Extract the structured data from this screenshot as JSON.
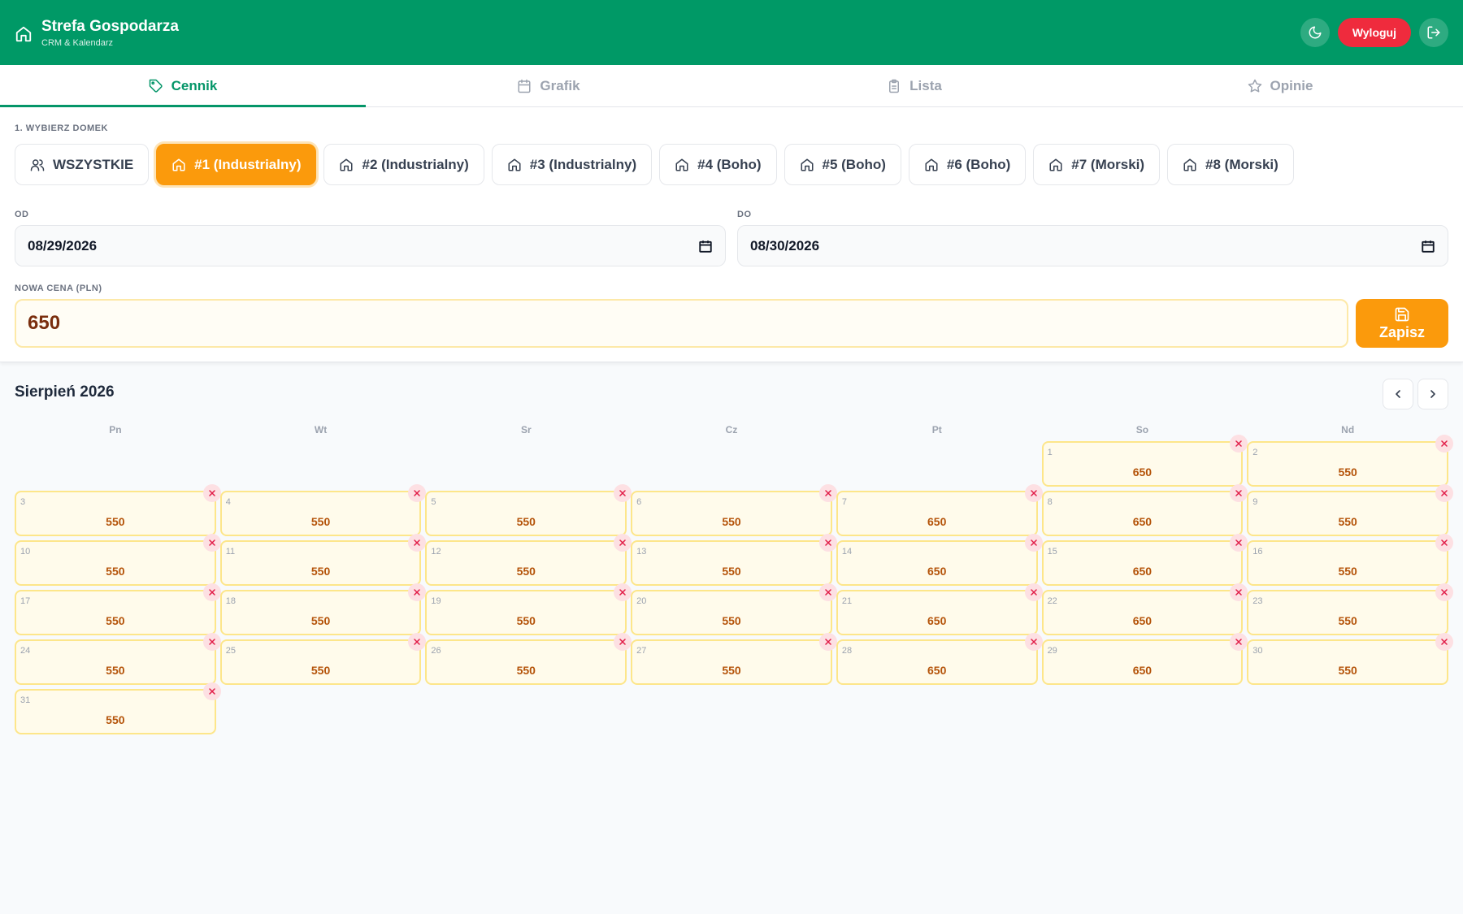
{
  "header": {
    "title": "Strefa Gospodarza",
    "subtitle": "CRM & Kalendarz",
    "logout_label": "Wyloguj"
  },
  "tabs": [
    {
      "label": "Cennik",
      "icon": "tag-icon",
      "active": true
    },
    {
      "label": "Grafik",
      "icon": "calendar-icon",
      "active": false
    },
    {
      "label": "Lista",
      "icon": "clipboard-icon",
      "active": false
    },
    {
      "label": "Opinie",
      "icon": "star-icon",
      "active": false
    }
  ],
  "form": {
    "house_label": "1. WYBIERZ DOMEK",
    "houses": [
      {
        "label": "WSZYSTKIE",
        "icon": "users-icon",
        "active": false
      },
      {
        "label": "#1 (Industrialny)",
        "icon": "home-icon",
        "active": true
      },
      {
        "label": "#2 (Industrialny)",
        "icon": "home-icon",
        "active": false
      },
      {
        "label": "#3 (Industrialny)",
        "icon": "home-icon",
        "active": false
      },
      {
        "label": "#4 (Boho)",
        "icon": "home-icon",
        "active": false
      },
      {
        "label": "#5 (Boho)",
        "icon": "home-icon",
        "active": false
      },
      {
        "label": "#6 (Boho)",
        "icon": "home-icon",
        "active": false
      },
      {
        "label": "#7 (Morski)",
        "icon": "home-icon",
        "active": false
      },
      {
        "label": "#8 (Morski)",
        "icon": "home-icon",
        "active": false
      }
    ],
    "from_label": "OD",
    "from_value": "08/29/2026",
    "to_label": "DO",
    "to_value": "08/30/2026",
    "price_label": "NOWA CENA (PLN)",
    "price_value": "650",
    "save_label": "Zapisz"
  },
  "calendar": {
    "month_label": "Sierpień 2026",
    "weekdays": [
      "Pn",
      "Wt",
      "Sr",
      "Cz",
      "Pt",
      "So",
      "Nd"
    ],
    "leading_empty": 5,
    "days": [
      {
        "day": "1",
        "price": "650"
      },
      {
        "day": "2",
        "price": "550"
      },
      {
        "day": "3",
        "price": "550"
      },
      {
        "day": "4",
        "price": "550"
      },
      {
        "day": "5",
        "price": "550"
      },
      {
        "day": "6",
        "price": "550"
      },
      {
        "day": "7",
        "price": "650"
      },
      {
        "day": "8",
        "price": "650"
      },
      {
        "day": "9",
        "price": "550"
      },
      {
        "day": "10",
        "price": "550"
      },
      {
        "day": "11",
        "price": "550"
      },
      {
        "day": "12",
        "price": "550"
      },
      {
        "day": "13",
        "price": "550"
      },
      {
        "day": "14",
        "price": "650"
      },
      {
        "day": "15",
        "price": "650"
      },
      {
        "day": "16",
        "price": "550"
      },
      {
        "day": "17",
        "price": "550"
      },
      {
        "day": "18",
        "price": "550"
      },
      {
        "day": "19",
        "price": "550"
      },
      {
        "day": "20",
        "price": "550"
      },
      {
        "day": "21",
        "price": "650"
      },
      {
        "day": "22",
        "price": "650"
      },
      {
        "day": "23",
        "price": "550"
      },
      {
        "day": "24",
        "price": "550"
      },
      {
        "day": "25",
        "price": "550"
      },
      {
        "day": "26",
        "price": "550"
      },
      {
        "day": "27",
        "price": "550"
      },
      {
        "day": "28",
        "price": "650"
      },
      {
        "day": "29",
        "price": "650"
      },
      {
        "day": "30",
        "price": "550"
      },
      {
        "day": "31",
        "price": "550"
      }
    ]
  },
  "colors": {
    "brand": "#009966",
    "accent": "#fb9a0c",
    "danger": "#ef2b3d"
  }
}
